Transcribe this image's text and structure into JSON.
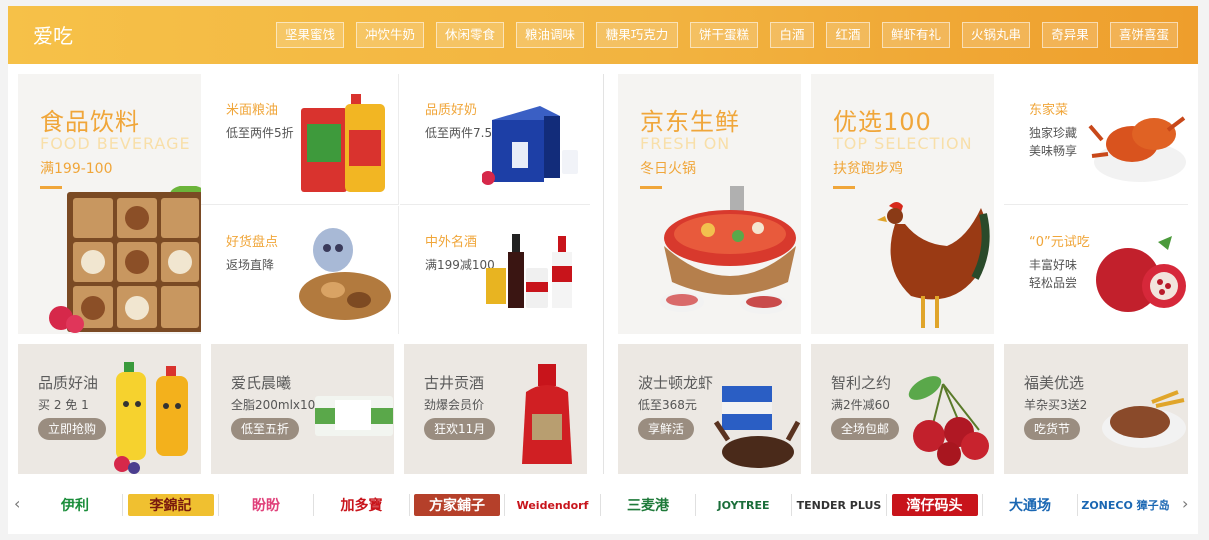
{
  "header": {
    "title": "爱吃",
    "tags": [
      "坚果蜜饯",
      "冲饮牛奶",
      "休闲零食",
      "粮油调味",
      "糖果巧克力",
      "饼干蛋糕",
      "白酒",
      "红酒",
      "鲜虾有礼",
      "火锅丸串",
      "奇异果",
      "喜饼喜蛋"
    ]
  },
  "left_panel": {
    "banner": {
      "title": "食品饮料",
      "en": "FOOD BEVERAGE",
      "sub": "满199-100"
    },
    "cells": [
      {
        "title": "米面粮油",
        "desc": "低至两件5折"
      },
      {
        "title": "品质好奶",
        "desc": "低至两件7.5折"
      },
      {
        "title": "好货盘点",
        "desc": "返场直降"
      },
      {
        "title": "中外名酒",
        "desc": "满199减100"
      }
    ],
    "bottom": [
      {
        "title": "品质好油",
        "desc": "买 2 免 1",
        "button": "立即抢购"
      },
      {
        "title": "爱氏晨曦",
        "desc": "全脂200mlx10",
        "button": "低至五折"
      },
      {
        "title": "古井贡酒",
        "desc": "劲爆会员价",
        "button": "狂欢11月"
      }
    ]
  },
  "right_panel": {
    "banner1": {
      "title": "京东生鲜",
      "en": "FRESH ON",
      "sub": "冬日火锅"
    },
    "banner2": {
      "title": "优选100",
      "en": "TOP SELECTION",
      "sub": "扶贫跑步鸡"
    },
    "cells": [
      {
        "title": "东家菜",
        "desc": "独家珍藏美味畅享"
      },
      {
        "title": "“0”元试吃",
        "desc": "丰富好味轻松品尝"
      }
    ],
    "bottom": [
      {
        "title": "波士顿龙虾",
        "desc": "低至368元",
        "button": "享鲜活"
      },
      {
        "title": "智利之约",
        "desc": "满2件减60",
        "button": "全场包邮"
      },
      {
        "title": "福美优选",
        "desc": "羊杂买3送2",
        "button": "吃货节"
      }
    ]
  },
  "brands": {
    "prev": "‹",
    "next": "›",
    "items": [
      {
        "name": "伊利",
        "color": "#1a8d3a"
      },
      {
        "name": "李錦記",
        "color": "#7a1a0e"
      },
      {
        "name": "盼盼",
        "color": "#e0407a"
      },
      {
        "name": "加多寶",
        "color": "#c8141b"
      },
      {
        "name": "方家鋪子",
        "color": "#ffffff"
      },
      {
        "name": "Weidendorf",
        "color": "#c8141b"
      },
      {
        "name": "三麦港",
        "color": "#1f7a3a"
      },
      {
        "name": "JOYTREE",
        "color": "#1b6e3a"
      },
      {
        "name": "TENDER PLUS",
        "color": "#333333"
      },
      {
        "name": "湾仔码头",
        "color": "#ffffff"
      },
      {
        "name": "大通场",
        "color": "#1a67b3"
      },
      {
        "name": "ZONECO 獐子岛",
        "color": "#1a67b3"
      }
    ]
  }
}
